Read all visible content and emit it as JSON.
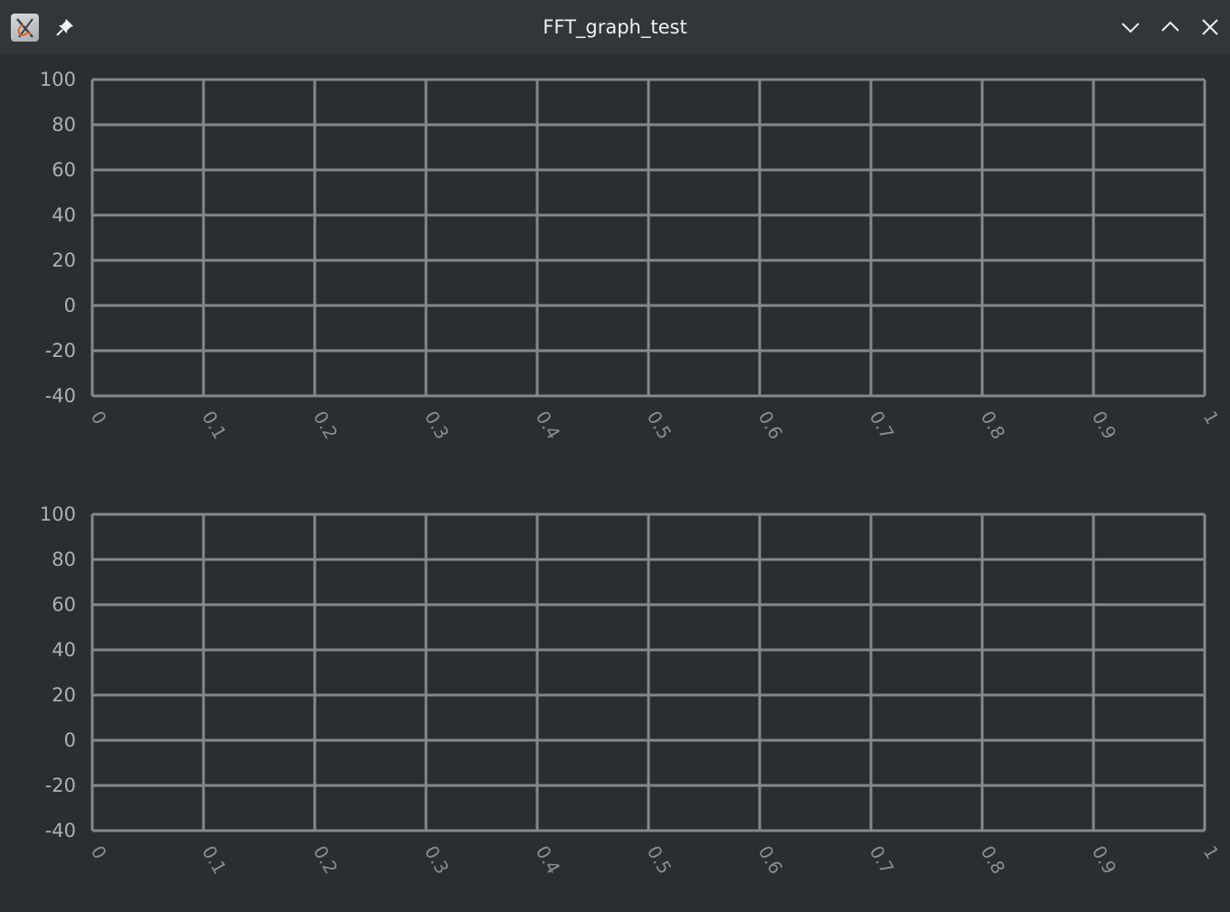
{
  "window": {
    "title": "FFT_graph_test",
    "app_icon": "app-icon",
    "buttons": [
      "pin-icon",
      "chevron-down-icon",
      "chevron-up-icon",
      "close-icon"
    ]
  },
  "chart_data": [
    {
      "type": "line",
      "series": [],
      "x_ticks": [
        "0",
        "0.1",
        "0.2",
        "0.3",
        "0.4",
        "0.5",
        "0.6",
        "0.7",
        "0.8",
        "0.9",
        "1"
      ],
      "y_ticks": [
        "100",
        "80",
        "60",
        "40",
        "20",
        "0",
        "-20",
        "-40"
      ],
      "xlim": [
        0,
        1
      ],
      "ylim": [
        -40,
        100
      ],
      "grid": true
    },
    {
      "type": "line",
      "series": [],
      "x_ticks": [
        "0",
        "0.1",
        "0.2",
        "0.3",
        "0.4",
        "0.5",
        "0.6",
        "0.7",
        "0.8",
        "0.9",
        "1"
      ],
      "y_ticks": [
        "100",
        "80",
        "60",
        "40",
        "20",
        "0",
        "-20",
        "-40"
      ],
      "xlim": [
        0,
        1
      ],
      "ylim": [
        -40,
        100
      ],
      "grid": true
    }
  ]
}
